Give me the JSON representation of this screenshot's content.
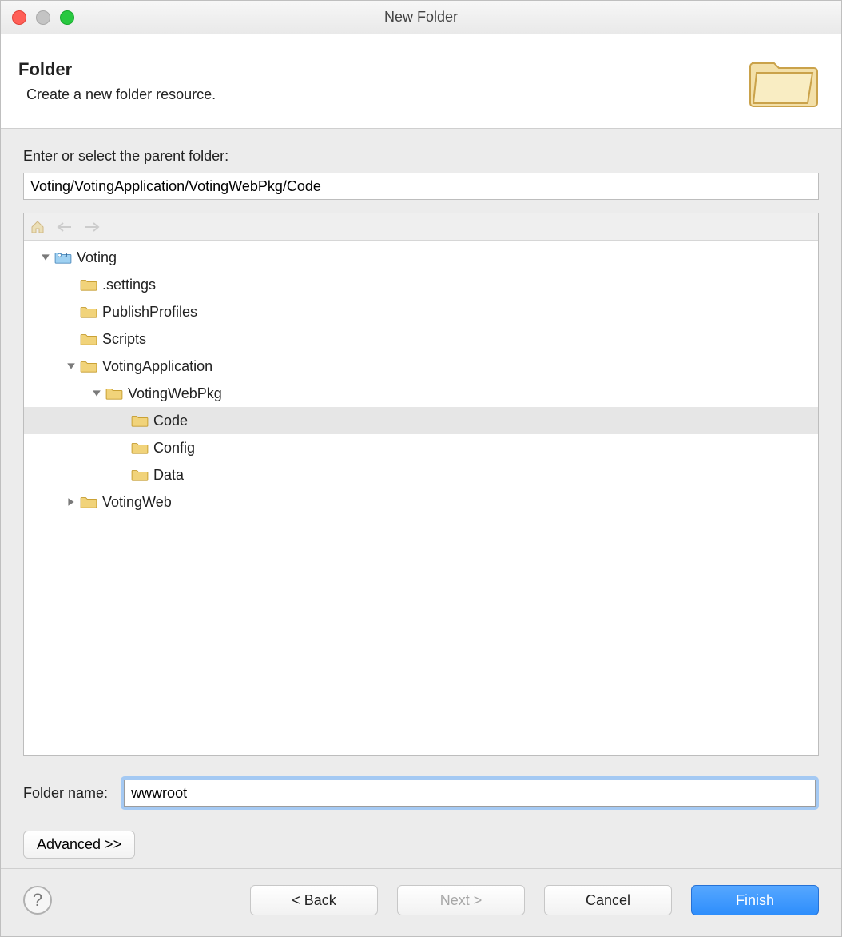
{
  "window": {
    "title": "New Folder"
  },
  "banner": {
    "heading": "Folder",
    "sub": "Create a new folder resource."
  },
  "parent_label": "Enter or select the parent folder:",
  "parent_path": "Voting/VotingApplication/VotingWebPkg/Code",
  "tree": [
    {
      "depth": 0,
      "arrow": "down",
      "icon": "project",
      "label": "Voting",
      "selected": false
    },
    {
      "depth": 1,
      "arrow": "none",
      "icon": "folder",
      "label": ".settings",
      "selected": false
    },
    {
      "depth": 1,
      "arrow": "none",
      "icon": "folder",
      "label": "PublishProfiles",
      "selected": false
    },
    {
      "depth": 1,
      "arrow": "none",
      "icon": "folder",
      "label": "Scripts",
      "selected": false
    },
    {
      "depth": 1,
      "arrow": "down",
      "icon": "folder",
      "label": "VotingApplication",
      "selected": false
    },
    {
      "depth": 2,
      "arrow": "down",
      "icon": "folder",
      "label": "VotingWebPkg",
      "selected": false
    },
    {
      "depth": 3,
      "arrow": "none",
      "icon": "folder",
      "label": "Code",
      "selected": true
    },
    {
      "depth": 3,
      "arrow": "none",
      "icon": "folder",
      "label": "Config",
      "selected": false
    },
    {
      "depth": 3,
      "arrow": "none",
      "icon": "folder",
      "label": "Data",
      "selected": false
    },
    {
      "depth": 1,
      "arrow": "right",
      "icon": "folder",
      "label": "VotingWeb",
      "selected": false
    }
  ],
  "folder_name_label": "Folder name:",
  "folder_name_value": "wwwroot",
  "advanced_label": "Advanced >>",
  "buttons": {
    "back": "< Back",
    "next": "Next >",
    "cancel": "Cancel",
    "finish": "Finish"
  }
}
